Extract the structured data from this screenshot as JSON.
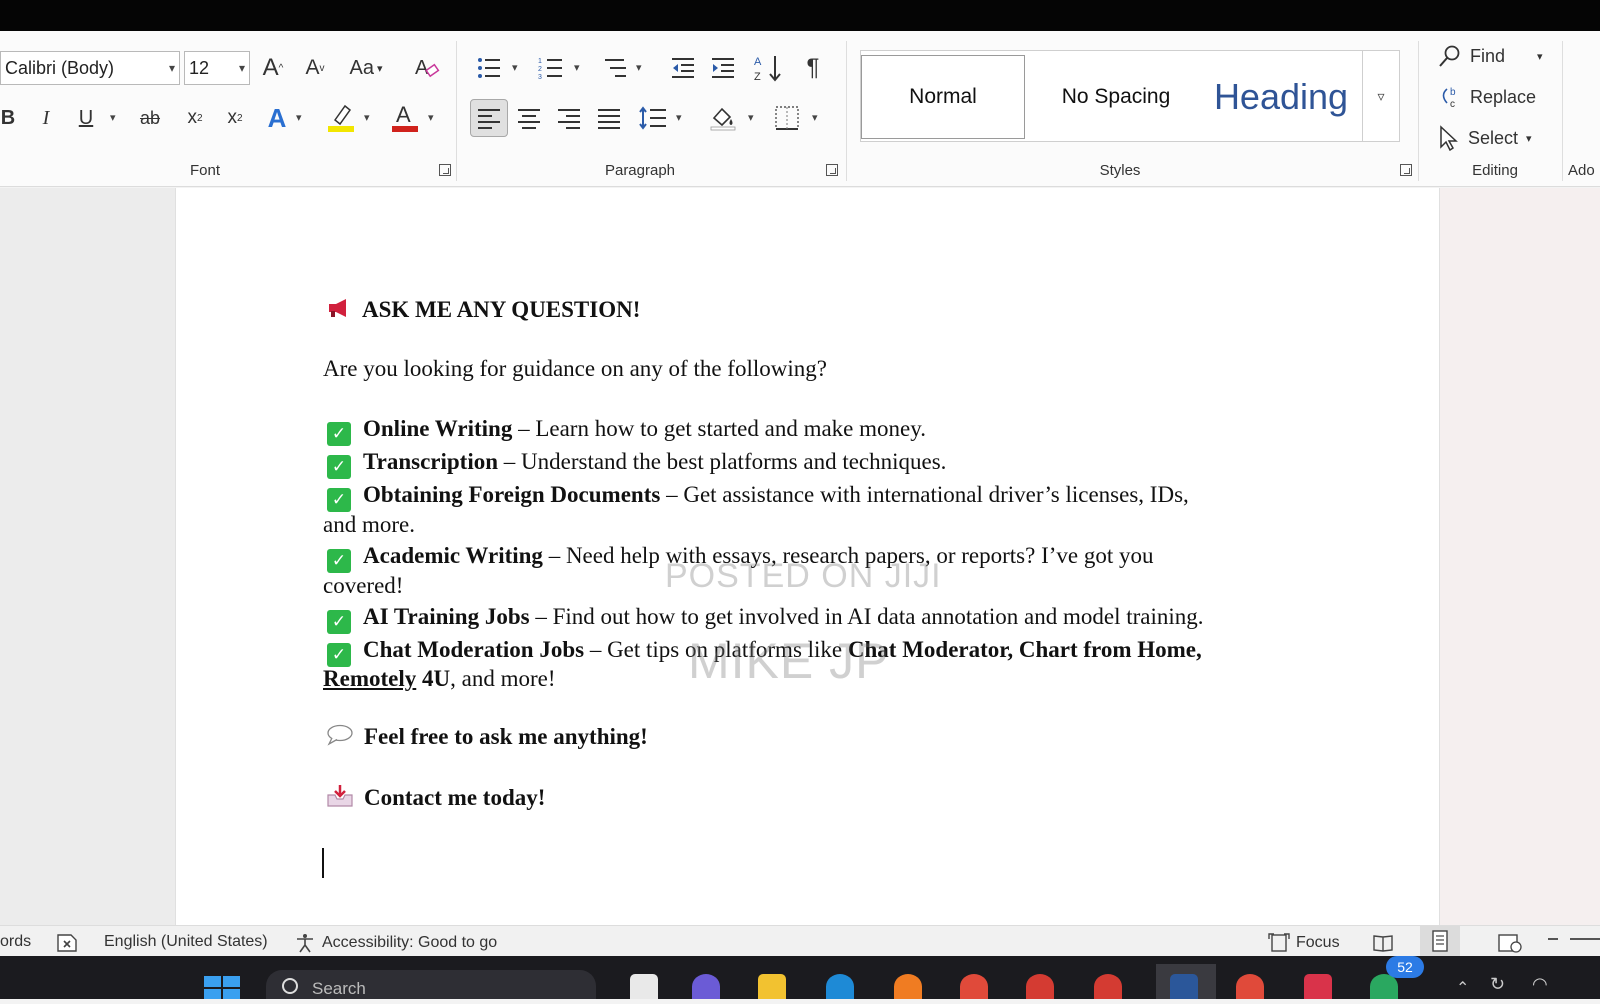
{
  "ribbon": {
    "font": {
      "group_label": "Font",
      "font_name": "Calibri (Body)",
      "font_size": "12",
      "grow_label": "A",
      "shrink_label": "A",
      "case_label": "Aa",
      "bold_label": "B",
      "italic_label": "I",
      "underline_label": "U",
      "strike_label": "ab",
      "subscript_label": "x",
      "superscript_label": "x",
      "highlight_color": "#f2e600",
      "font_color": "#d0221c"
    },
    "paragraph": {
      "group_label": "Paragraph"
    },
    "styles": {
      "group_label": "Styles",
      "items": [
        {
          "label": "Normal"
        },
        {
          "label": "No Spacing"
        },
        {
          "label": "Heading"
        }
      ]
    },
    "editing": {
      "group_label": "Editing",
      "find_label": "Find",
      "replace_label": "Replace",
      "select_label": "Select"
    },
    "addins": {
      "group_label": "Ado"
    }
  },
  "document": {
    "heading": "ASK ME ANY QUESTION!",
    "intro": "Are you looking for guidance on any of the following?",
    "items": [
      {
        "title": "Online Writing",
        "desc": " – Learn how to get started and make money."
      },
      {
        "title": "Transcription",
        "desc": " – Understand the best platforms and techniques."
      },
      {
        "title": "Obtaining Foreign Documents",
        "desc": " – Get assistance with international driver’s licenses, IDs,",
        "cont": "and more."
      },
      {
        "title": "Academic Writing",
        "desc": " – Need help with essays, research papers, or reports? I’ve got you",
        "cont": "covered!"
      },
      {
        "title": "AI Training Jobs",
        "desc": " – Find out how to get involved in AI data annotation and model training."
      },
      {
        "title": "Chat Moderation Jobs",
        "desc": " – Get tips on platforms like ",
        "bold_tail": "Chat Moderator, Chart from Home,",
        "cont_bold": "Remotely",
        "cont_bold2": " 4U",
        "cont_tail": ", and more!"
      }
    ],
    "ask": "Feel free to ask me anything!",
    "contact": "Contact me today!",
    "watermark_top": "POSTED ON JIJI",
    "watermark_bottom": "MIKE JP"
  },
  "status": {
    "words": "ords",
    "language": "English (United States)",
    "accessibility": "Accessibility: Good to go",
    "focus": "Focus"
  },
  "taskbar": {
    "search": "Search",
    "badge": "52"
  }
}
